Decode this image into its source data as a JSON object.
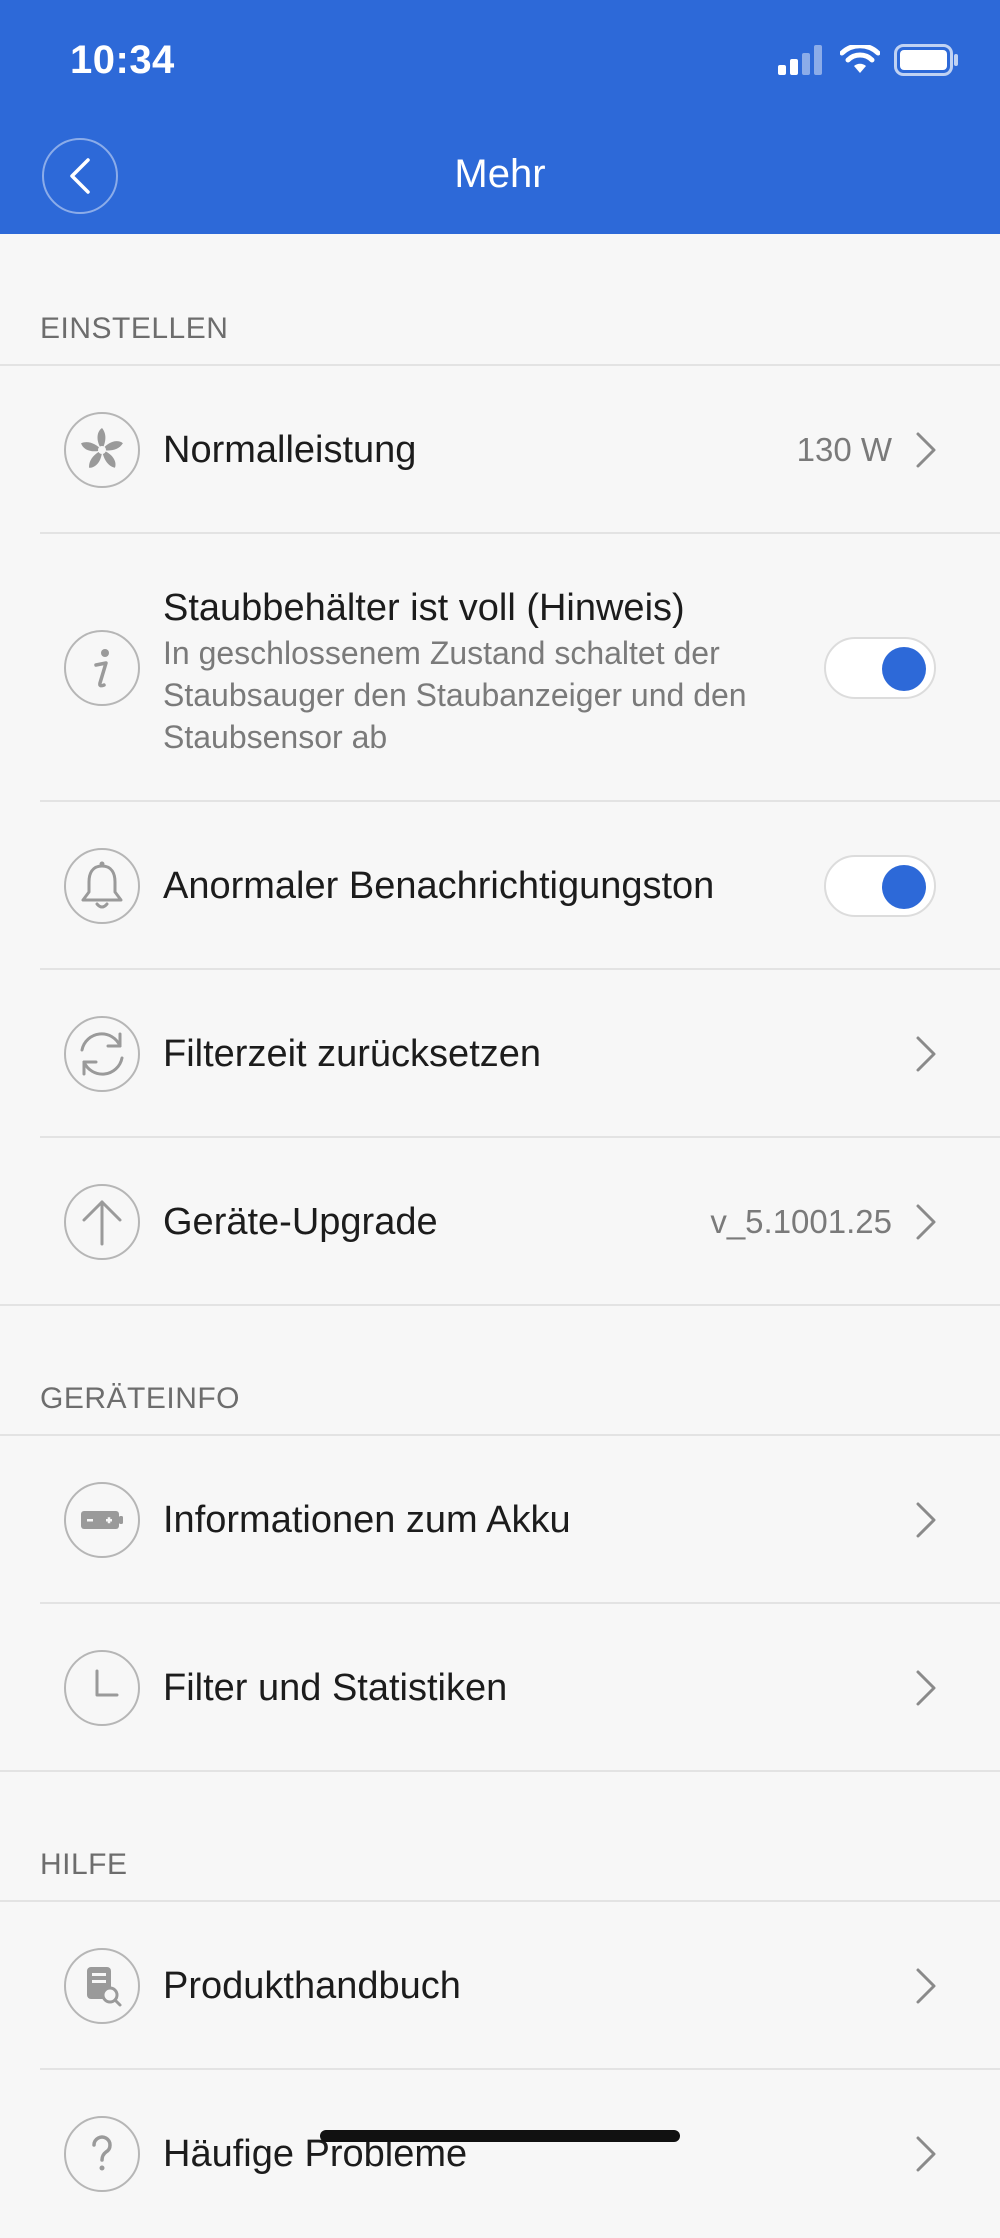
{
  "status_bar": {
    "time": "10:34"
  },
  "nav": {
    "title": "Mehr"
  },
  "sections": [
    {
      "header": "EINSTELLEN",
      "items": [
        {
          "label": "Normalleistung",
          "value": "130 W"
        },
        {
          "label": "Staubbehälter ist voll (Hinweis)",
          "description": "In geschlossenem Zustand schaltet der Staubsauger den Staubanzeiger und den Staubsensor ab",
          "toggle_on": true
        },
        {
          "label": "Anormaler Benachrichtigungston",
          "toggle_on": true
        },
        {
          "label": "Filterzeit zurücksetzen"
        },
        {
          "label": "Geräte-Upgrade",
          "value": "v_5.1001.25"
        }
      ]
    },
    {
      "header": "GERÄTEINFO",
      "items": [
        {
          "label": "Informationen zum Akku"
        },
        {
          "label": "Filter und Statistiken"
        }
      ]
    },
    {
      "header": "HILFE",
      "items": [
        {
          "label": "Produkthandbuch"
        },
        {
          "label": "Häufige Probleme"
        }
      ]
    }
  ],
  "colors": {
    "accent": "#2d69d8",
    "background": "#f7f7f7",
    "divider": "#e3e3e3"
  },
  "icons": [
    "fan-icon",
    "info-icon",
    "bell-icon",
    "refresh-icon",
    "upgrade-arrow-icon",
    "battery-icon",
    "clock-icon",
    "manual-icon",
    "help-icon"
  ]
}
